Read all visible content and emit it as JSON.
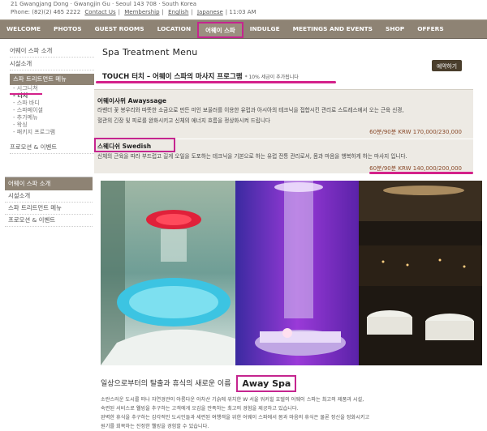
{
  "topinfo": {
    "address": "21 Gwangjang Dong · Gwangjin Gu · Seoul 143 708 · South Korea",
    "phone": "Phone: (82)(2) 465 2222",
    "links": [
      "Contact Us",
      "Membership",
      "English",
      "Japanese"
    ],
    "time": "11:03 AM"
  },
  "nav": {
    "items": [
      "WELCOME",
      "PHOTOS",
      "GUEST ROOMS",
      "LOCATION",
      "어웨이 스파",
      "INDULGE",
      "MEETINGS AND EVENTS",
      "SHOP",
      "OFFERS"
    ],
    "active_index": 4
  },
  "sidebar": {
    "links_top": [
      "어웨이 스파 소개",
      "시설소개"
    ],
    "section_title": "스파 트리트먼트 메뉴",
    "sub_items": [
      "시그니쳐",
      "터치",
      "스파 바디",
      "스파페이셜",
      "추가메뉴",
      "왁싱",
      "패키지 프로그램"
    ],
    "active_sub": 1,
    "promo": "프로모션 & 이벤트"
  },
  "sidebar2": {
    "title": "어웨이 스파 소개",
    "links": [
      "시설소개",
      "스파 트리트먼트 메뉴",
      "프로모션 & 이벤트"
    ]
  },
  "main": {
    "title": "Spa Treatment Menu",
    "reserve_button": "예약하기",
    "touch_heading": "TOUCH 터치 – 어웨이 스파의 마사지 프로그램",
    "touch_note": "* 10% 세금이 추가됩니다",
    "treatments": [
      {
        "name": "어웨이사위 Awayssage",
        "desc1": "라벤더 꽃 봉우리와 따뜻한 소금으로 만든 미인 보울러를 이용한 유럽과 아시아의 테크닉을 접합시킨 관리로 스트레스에서 오는 근육 신경,",
        "desc2": "혈관의 긴장 및 피로를 완화시키고 신체의 에너지 흐름을 정상화시켜 드립니다",
        "price": "60분/90분 KRW 170,000/230,000"
      },
      {
        "name": "스웨디쉬 Swedish",
        "desc1": "신체의 근육을 따라 부드럽고 길게 오일을 도포하는 테크닉을 기본으로 하는 유럽 전통 관리로서, 몸과 마음을 행복하게 하는 마사지 입니다.",
        "price": "60분/90분 KRW 140,000/200,000"
      }
    ]
  },
  "bottom": {
    "tagline": "일상으로부터의 탈출과 휴식의 새로운 이름",
    "brand": "Away Spa",
    "lines": [
      "소란스러운 도시를 떠나 자연경관이 아름다운 아차산 기슭에 위치한 W 서울 워커힐 호텔의 어웨이 스파는 최고의 제품과 시설,",
      "숙련된 서비스로 웰빙을 추구하는 고객에게 오감을 만족하는 최고의 경험을 제공하고 있습니다.",
      "완벽한 휴식을 추구하는 감각적인 도시인들과 세련된 여행객을 위한 어웨이 스파에서 몸과 마음의 휴식은 물론 정신을 정화시키고",
      "원기를 회복하는 진정한 웰빙을 경험할 수 있습니다."
    ]
  },
  "colors": {
    "nav_bg": "#8e8374",
    "highlight": "#c5258f",
    "box_bg": "#edeae4"
  }
}
